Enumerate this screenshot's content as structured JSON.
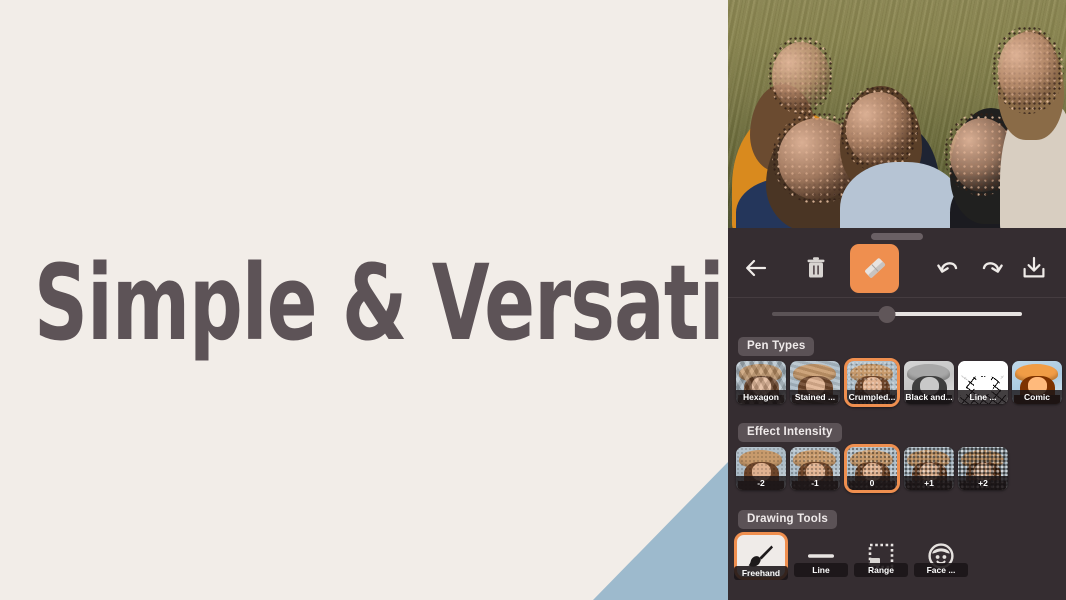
{
  "promo": {
    "headline": "Simple & Versatile",
    "bg_color": "#f2ede8",
    "text_color": "#5d5357",
    "accent_shape_color": "#9dbacd"
  },
  "app": {
    "background": "#352d31",
    "accent_color": "#ef8f4f",
    "canvas": {
      "name": "photo-canvas",
      "description": "Group of people sitting on grass, faces obscured with crumpled-paper effect"
    },
    "drag_handle": "panel-drag-handle",
    "toolbar": {
      "back_label": "Back",
      "delete_label": "Delete",
      "eraser_label": "Eraser",
      "undo_label": "Undo",
      "redo_label": "Redo",
      "save_label": "Save",
      "eraser_selected": true
    },
    "brush_slider": {
      "label": "Brush Size",
      "value": 46,
      "min": 0,
      "max": 100
    },
    "sections": [
      {
        "id": "pen-types",
        "label": "Pen Types",
        "items": [
          {
            "label": "Hexagon",
            "art": "art-hexagon",
            "selected": false
          },
          {
            "label": "Stained ...",
            "art": "art-stained",
            "selected": false
          },
          {
            "label": "Crumpled...",
            "art": "art-crumple",
            "selected": true
          },
          {
            "label": "Black and...",
            "art": "art-bw",
            "selected": false
          },
          {
            "label": "Line ...",
            "art": "art-line",
            "selected": false
          },
          {
            "label": "Comic",
            "art": "art-comic",
            "selected": false
          }
        ]
      },
      {
        "id": "effect-intensity",
        "label": "Effect Intensity",
        "items": [
          {
            "label": "-2",
            "art": "lvl lvl0",
            "selected": false
          },
          {
            "label": "-1",
            "art": "lvl lvl1",
            "selected": false
          },
          {
            "label": "0",
            "art": "lvl lvl2",
            "selected": true
          },
          {
            "label": "+1",
            "art": "lvl lvl3",
            "selected": false
          },
          {
            "label": "+2",
            "art": "lvl lvl4",
            "selected": false
          }
        ]
      }
    ],
    "drawing_tools": {
      "label": "Drawing Tools",
      "items": [
        {
          "label": "Freehand",
          "icon": "brush-icon",
          "selected": true
        },
        {
          "label": "Line",
          "icon": "line-icon",
          "selected": false
        },
        {
          "label": "Range",
          "icon": "selection-box-icon",
          "selected": false
        },
        {
          "label": "Face ...",
          "icon": "face-icon",
          "selected": false
        }
      ]
    }
  }
}
